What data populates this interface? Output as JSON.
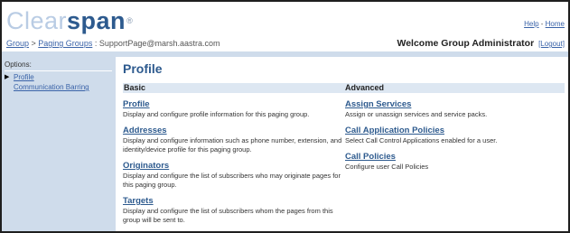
{
  "brand": {
    "light": "Clear",
    "dark": "span",
    "tm": "®"
  },
  "top_links": {
    "help": "Help",
    "sep": " - ",
    "home": "Home"
  },
  "breadcrumb": {
    "group": "Group",
    "sep1": " > ",
    "paging_groups": "Paging Groups",
    "sep2": " : ",
    "current": "SupportPage@marsh.aastra.com"
  },
  "welcome": {
    "text": "Welcome Group Administrator",
    "logout": "[Logout]"
  },
  "sidebar": {
    "options_label": "Options:",
    "items": [
      {
        "label": "Profile",
        "current": true
      },
      {
        "label": "Communication Barring",
        "current": false
      }
    ]
  },
  "page": {
    "title": "Profile"
  },
  "sections": {
    "basic": "Basic",
    "advanced": "Advanced"
  },
  "basic_items": [
    {
      "link": "Profile",
      "desc": "Display and configure profile information for this paging group."
    },
    {
      "link": "Addresses",
      "desc": "Display and configure information such as phone number, extension, and identity/device profile for this paging group."
    },
    {
      "link": "Originators",
      "desc": "Display and configure the list of subscribers who may originate pages for this paging group."
    },
    {
      "link": "Targets",
      "desc": "Display and configure the list of subscribers whom the pages from this group will be sent to."
    }
  ],
  "advanced_items": [
    {
      "link": "Assign Services",
      "desc": "Assign or unassign services and service packs."
    },
    {
      "link": "Call Application Policies",
      "desc": "Select Call Control Applications enabled for a user."
    },
    {
      "link": "Call Policies",
      "desc": "Configure user Call Policies"
    }
  ],
  "colors": {
    "accent": "#2d5a8e",
    "link": "#3a63a8",
    "sidebar_bg": "#cfdceb",
    "section_bar": "#dde7f2"
  }
}
